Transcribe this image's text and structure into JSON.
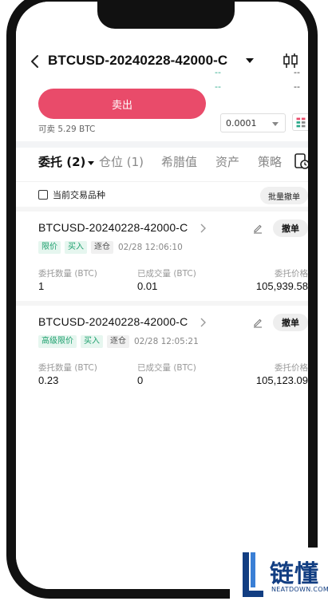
{
  "header": {
    "symbol": "BTCUSD-20240228-42000-C",
    "ask_price": "--",
    "ask_size": "--",
    "bid_price": "--",
    "bid_size": "--"
  },
  "trade": {
    "sell_label": "卖出",
    "available": "可卖  5.29 BTC",
    "quantity_step": "0.0001",
    "sell_color": "#e94b6a"
  },
  "tabs": [
    {
      "label": "委托 (2)"
    },
    {
      "label": "仓位 (1)"
    },
    {
      "label": "希腊值"
    },
    {
      "label": "资产"
    },
    {
      "label": "策略"
    }
  ],
  "filter": {
    "current_only_label": "当前交易品种",
    "bulk_cancel_label": "批量撤单"
  },
  "orders": [
    {
      "symbol": "BTCUSD-20240228-42000-C",
      "order_type": "限价",
      "side": "买入",
      "margin_mode": "逐仓",
      "time": "02/28 12:06:10",
      "cancel_label": "撤单",
      "qty_label": "委托数量 (BTC)",
      "qty": "1",
      "filled_label": "已成交量 (BTC)",
      "filled": "0.01",
      "price_label": "委托价格",
      "price": "105,939.58"
    },
    {
      "symbol": "BTCUSD-20240228-42000-C",
      "order_type": "高级限价",
      "side": "买入",
      "margin_mode": "逐仓",
      "time": "02/28 12:05:21",
      "cancel_label": "撤单",
      "qty_label": "委托数量 (BTC)",
      "qty": "0.23",
      "filled_label": "已成交量 (BTC)",
      "filled": "0",
      "price_label": "委托价格",
      "price": "105,123.09"
    }
  ],
  "watermark": {
    "brand_cn": "链懂",
    "brand_en": "NEATDOWN.COM"
  }
}
